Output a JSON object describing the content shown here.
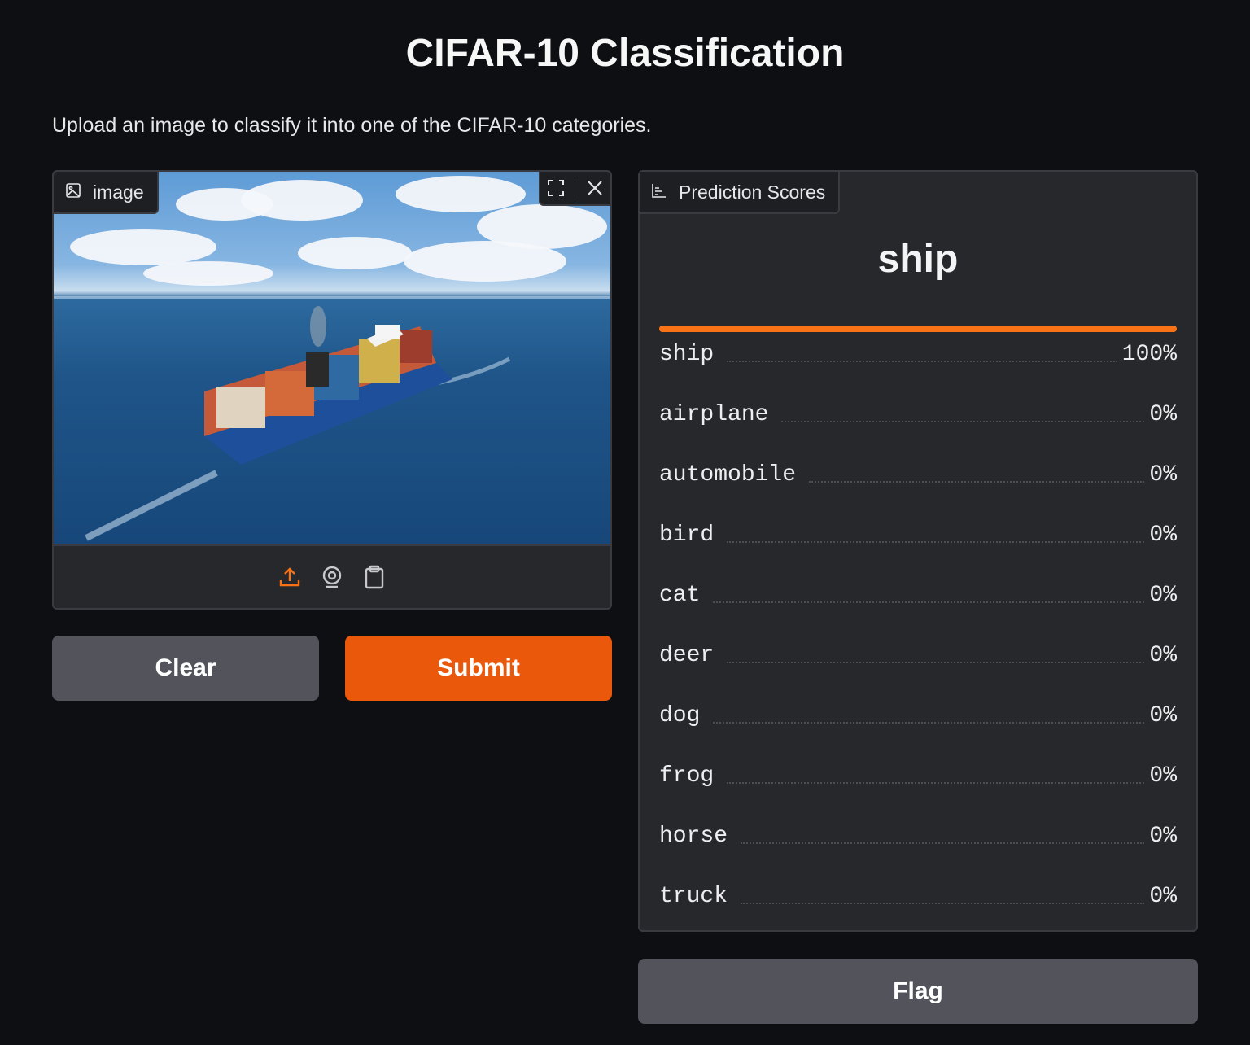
{
  "title": "CIFAR-10 Classification",
  "description": "Upload an image to classify it into one of the CIFAR-10 categories.",
  "image_input": {
    "label": "image",
    "label_icon": "image-icon",
    "actions": [
      "fullscreen-icon",
      "close-icon"
    ],
    "sources": [
      "upload-icon",
      "webcam-icon",
      "clipboard-icon"
    ]
  },
  "buttons": {
    "clear": "Clear",
    "submit": "Submit",
    "flag": "Flag"
  },
  "prediction": {
    "label": "Prediction Scores",
    "label_icon": "bar-chart-icon",
    "top_label": "ship",
    "top_confidence": 1.0,
    "scores": [
      {
        "label": "ship",
        "value": "100%"
      },
      {
        "label": "airplane",
        "value": "0%"
      },
      {
        "label": "automobile",
        "value": "0%"
      },
      {
        "label": "bird",
        "value": "0%"
      },
      {
        "label": "cat",
        "value": "0%"
      },
      {
        "label": "deer",
        "value": "0%"
      },
      {
        "label": "dog",
        "value": "0%"
      },
      {
        "label": "frog",
        "value": "0%"
      },
      {
        "label": "horse",
        "value": "0%"
      },
      {
        "label": "truck",
        "value": "0%"
      }
    ]
  },
  "colors": {
    "background": "#0e0f12",
    "panel": "#27282c",
    "accent": "#ea580c",
    "secondary_button": "#52535b"
  }
}
